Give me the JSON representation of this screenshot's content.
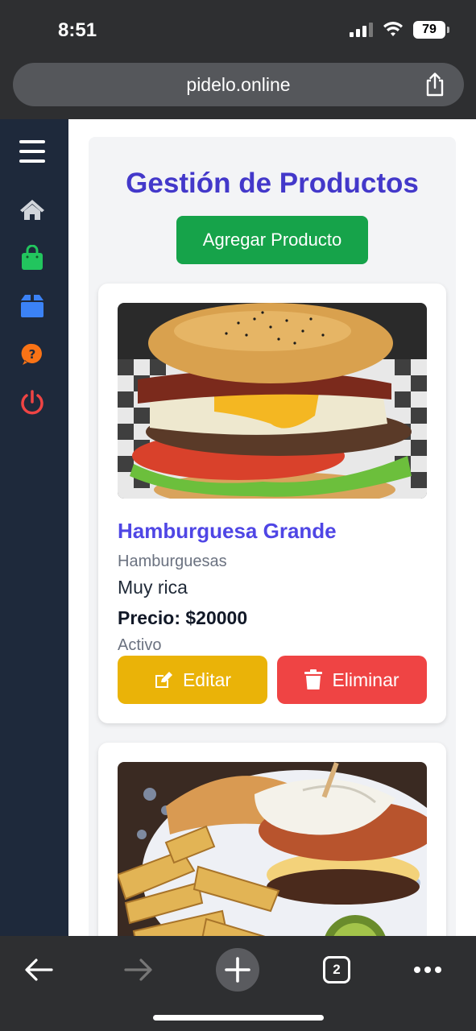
{
  "status": {
    "time": "8:51",
    "battery": "79"
  },
  "browser": {
    "url": "pidelo.online",
    "tab_count": "2"
  },
  "sidebar": {
    "items": [
      {
        "icon": "menu-icon",
        "color": "#ffffff"
      },
      {
        "icon": "home-icon",
        "color": "#d1d5db"
      },
      {
        "icon": "shopping-bag-icon",
        "color": "#22c55e"
      },
      {
        "icon": "box-icon",
        "color": "#3b82f6"
      },
      {
        "icon": "help-icon",
        "color": "#f97316"
      },
      {
        "icon": "power-icon",
        "color": "#ef4444"
      }
    ]
  },
  "main": {
    "title": "Gestión de Productos",
    "add_button": "Agregar Producto",
    "products": [
      {
        "name": "Hamburguesa Grande",
        "category": "Hamburguesas",
        "description": "Muy rica",
        "price": "Precio: $20000",
        "status": "Activo",
        "edit_label": "Editar",
        "delete_label": "Eliminar"
      }
    ]
  },
  "colors": {
    "title": "#4338ca",
    "add_button": "#16a34a",
    "edit_button": "#eab308",
    "delete_button": "#ef4444",
    "sidebar_bg": "#1e293b"
  }
}
